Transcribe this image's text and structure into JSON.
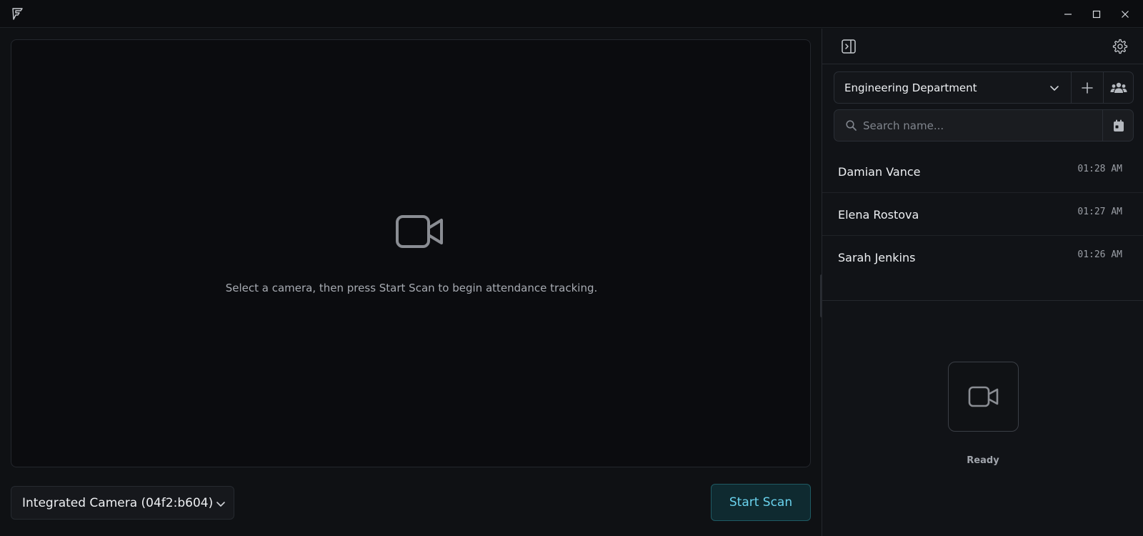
{
  "window": {
    "logo_icon": "app-logo-icon",
    "controls": [
      "minimize-icon",
      "maximize-icon",
      "close-icon"
    ]
  },
  "camera_preview": {
    "icon": "video-camera-icon",
    "message": "Select a camera, then press Start Scan to begin attendance tracking."
  },
  "camera_select": {
    "value": "Integrated Camera (04f2:b604)"
  },
  "start_scan": {
    "label": "Start Scan",
    "color": "#6ad3ee"
  },
  "sidebar": {
    "group_select": {
      "value": "Engineering Department"
    },
    "search": {
      "placeholder": "Search name..."
    },
    "attendance_log": [
      {
        "name": "Damian Vance",
        "time": "01:28 AM"
      },
      {
        "name": "Elena Rostova",
        "time": "01:27 AM"
      },
      {
        "name": "Sarah Jenkins",
        "time": "01:26 AM"
      }
    ],
    "status": {
      "label": "Ready",
      "icon": "video-camera-icon"
    }
  }
}
